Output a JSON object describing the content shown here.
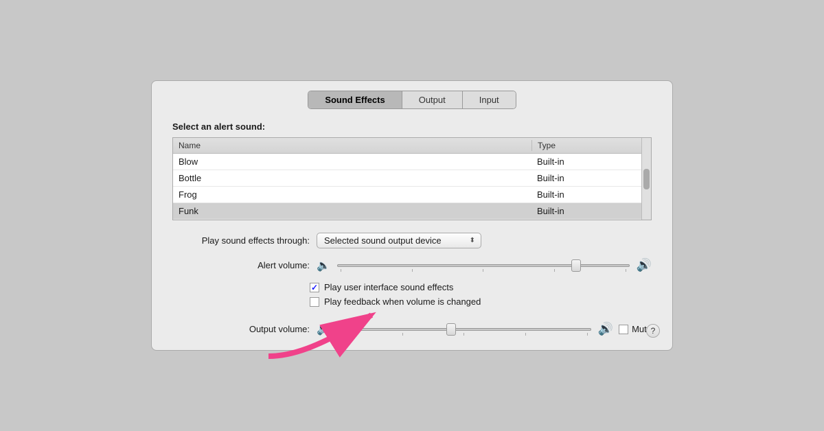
{
  "tabs": [
    {
      "id": "sound-effects",
      "label": "Sound Effects",
      "selected": true
    },
    {
      "id": "output",
      "label": "Output",
      "selected": false
    },
    {
      "id": "input",
      "label": "Input",
      "selected": false
    }
  ],
  "section": {
    "alert_label": "Select an alert sound:"
  },
  "sound_list": {
    "columns": [
      "Name",
      "Type"
    ],
    "rows": [
      {
        "name": "Blow",
        "type": "Built-in",
        "selected": false
      },
      {
        "name": "Bottle",
        "type": "Built-in",
        "selected": false
      },
      {
        "name": "Frog",
        "type": "Built-in",
        "selected": false
      },
      {
        "name": "Funk",
        "type": "Built-in",
        "selected": true
      }
    ]
  },
  "play_through": {
    "label": "Play sound effects through:",
    "value": "Selected sound output device"
  },
  "alert_volume": {
    "label": "Alert volume:",
    "value": 82
  },
  "checkboxes": [
    {
      "id": "ui-sound-effects",
      "label": "Play user interface sound effects",
      "checked": true
    },
    {
      "id": "feedback-volume",
      "label": "Play feedback when volume is changed",
      "checked": false
    }
  ],
  "output_volume": {
    "label": "Output volume:",
    "value": 45
  },
  "mute": {
    "label": "Mute",
    "checked": false
  },
  "help_button": "?",
  "icons": {
    "volume_low": "🔇",
    "volume_high": "🔊",
    "dropdown_arrow": "⬍"
  }
}
